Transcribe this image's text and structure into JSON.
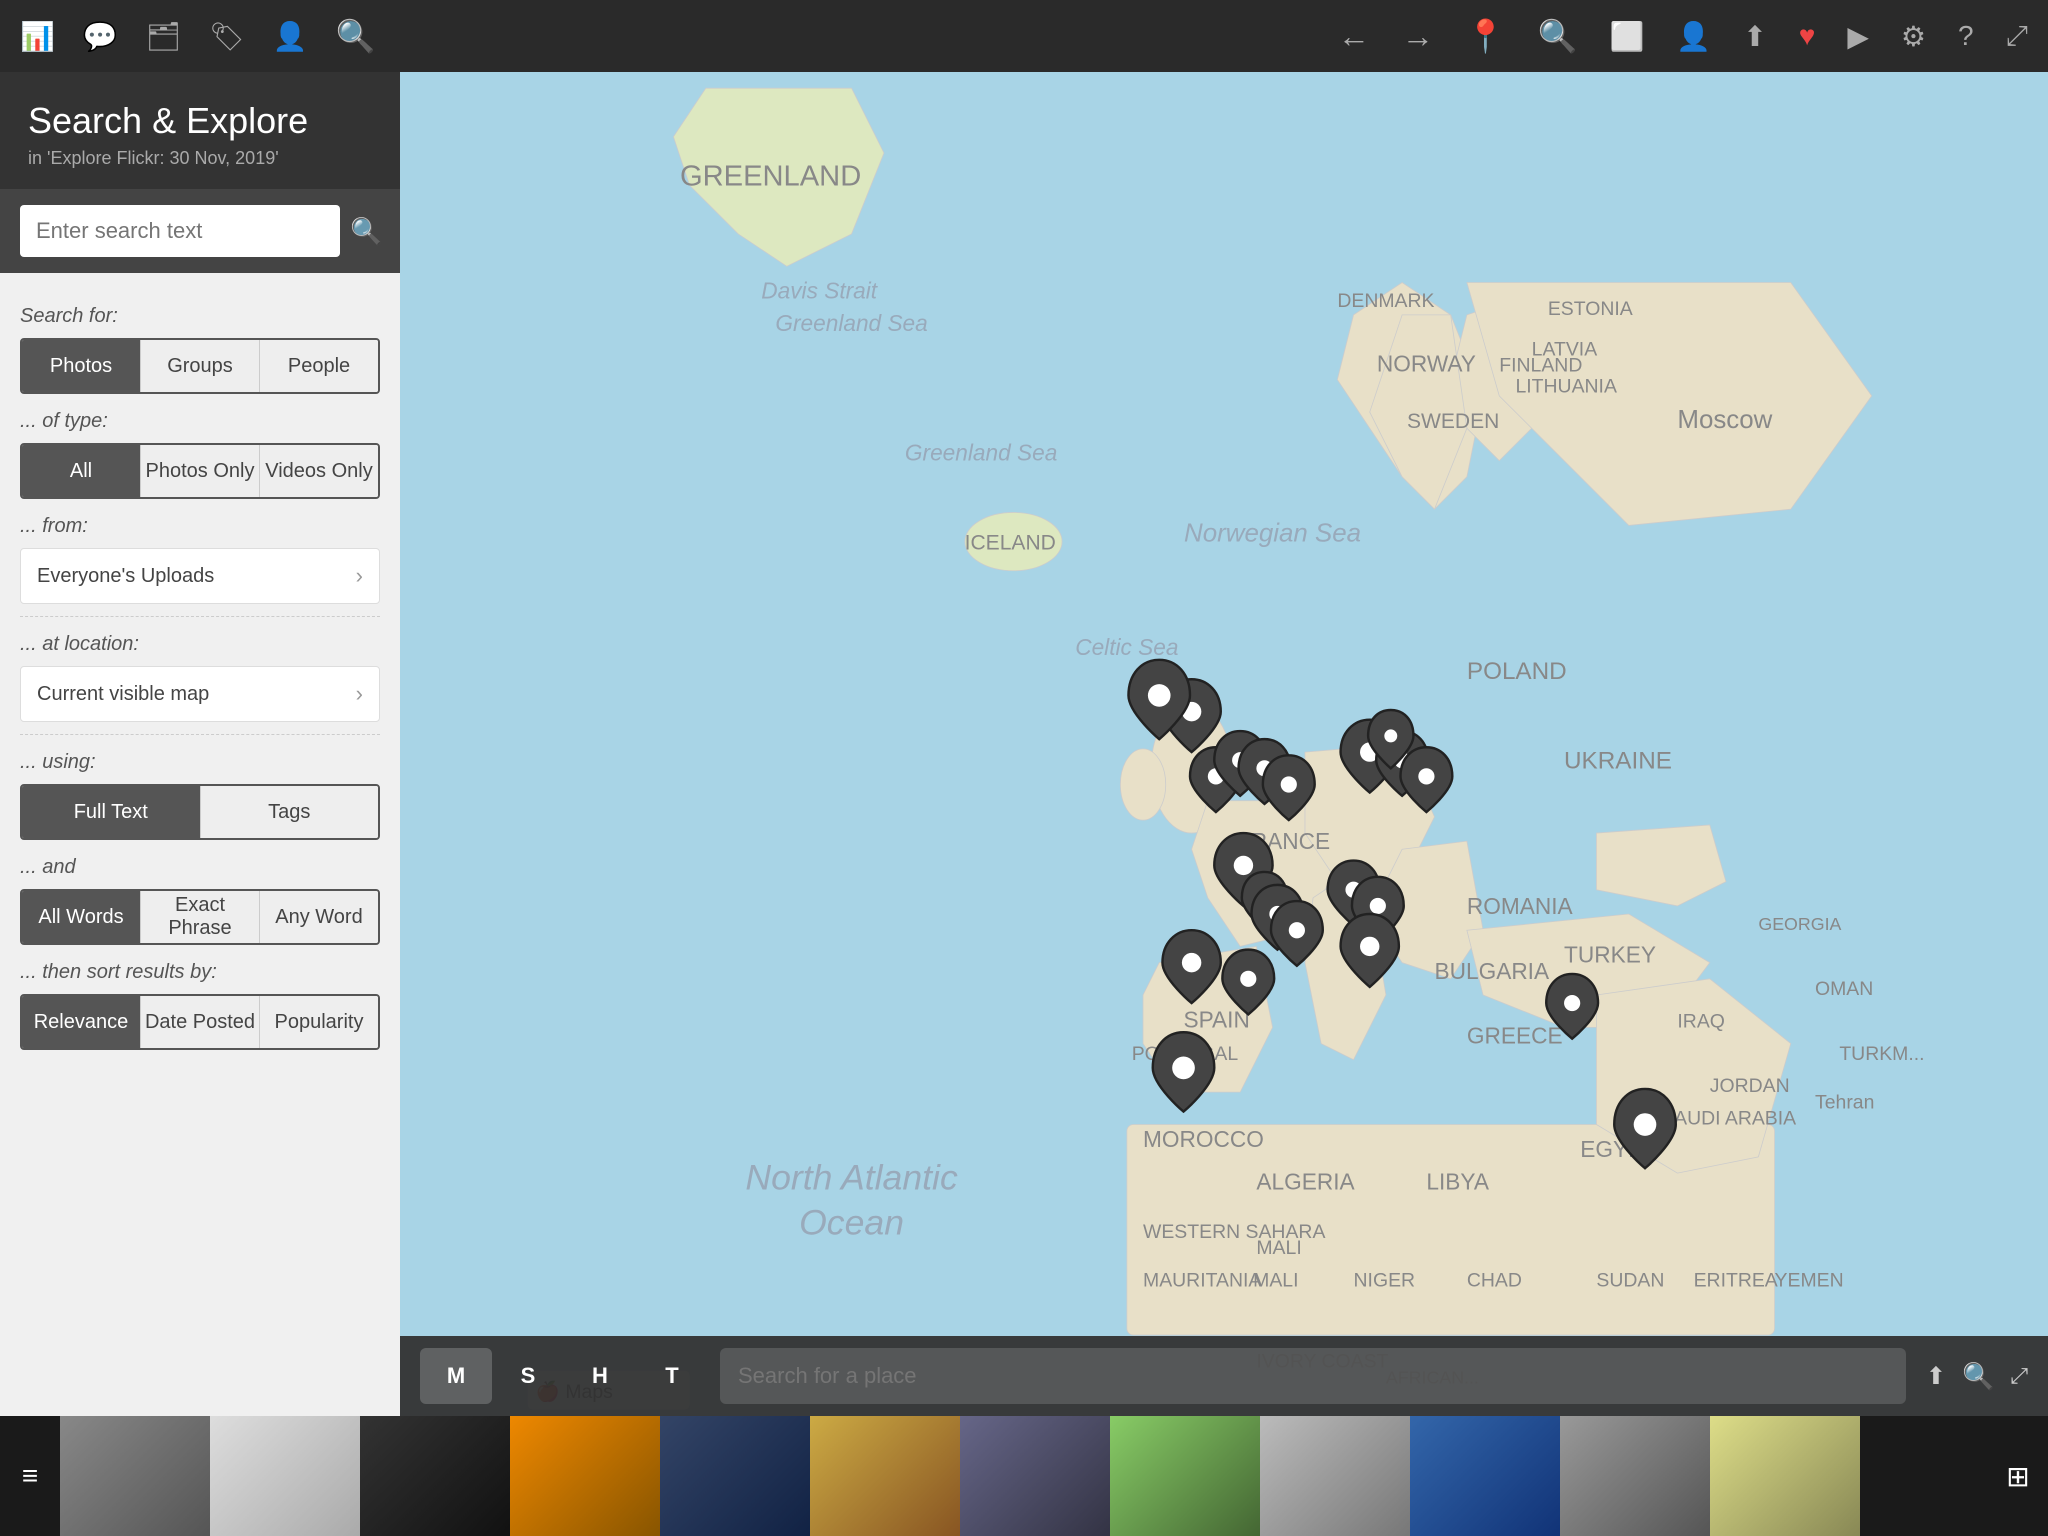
{
  "toolbar": {
    "icons": [
      "bar-chart",
      "comment",
      "copy",
      "tag",
      "person",
      "search"
    ],
    "nav_back": "←",
    "nav_forward": "→",
    "location": "📍",
    "search": "🔍",
    "square": "⬜",
    "person": "👤",
    "share": "⬆",
    "heart": "♥",
    "play": "▶",
    "settings": "⚙",
    "help": "?",
    "expand": "⤢"
  },
  "sidebar": {
    "title": "Search & Explore",
    "subtitle": "in 'Explore Flickr: 30 Nov, 2019'",
    "search_placeholder": "Enter search text",
    "search_for_label": "Search for:",
    "type_label": "... of type:",
    "from_label": "... from:",
    "location_label": "... at location:",
    "using_label": "... using:",
    "and_label": "... and",
    "sort_label": "... then sort results by:",
    "search_for_tabs": [
      "Photos",
      "Groups",
      "People"
    ],
    "type_tabs": [
      "All",
      "Photos Only",
      "Videos Only"
    ],
    "from_item": "Everyone's Uploads",
    "location_item": "Current visible map",
    "using_tabs": [
      "Full Text",
      "Tags"
    ],
    "and_tabs": [
      "All Words",
      "Exact Phrase",
      "Any Word"
    ],
    "sort_tabs": [
      "Relevance",
      "Date Posted",
      "Popularity"
    ]
  },
  "map": {
    "tabs": [
      "M",
      "S",
      "H",
      "T"
    ],
    "active_tab": "M",
    "search_placeholder": "Search for a place"
  },
  "bottom_strip": {
    "menu_label": "≡",
    "grid_label": "⊞",
    "photos": [
      "sp1",
      "sp2",
      "sp3",
      "sp4",
      "sp5",
      "sp6",
      "sp7",
      "sp8",
      "sp9",
      "sp10",
      "sp11",
      "sp12"
    ]
  }
}
